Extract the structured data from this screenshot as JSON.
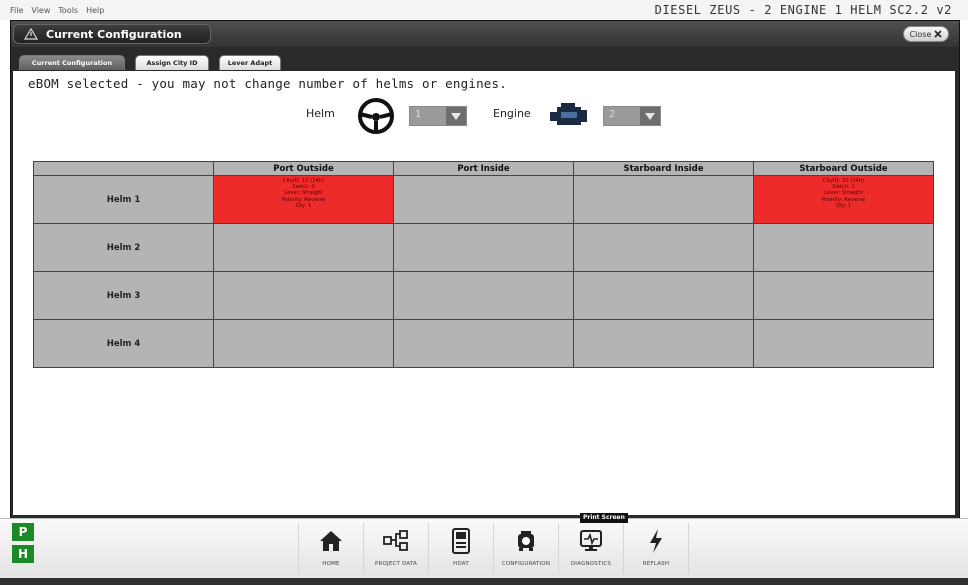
{
  "menu": {
    "items": [
      "File",
      "View",
      "Tools",
      "Help"
    ]
  },
  "app_title": "DIESEL ZEUS - 2 ENGINE 1 HELM SC2.2 v2",
  "window": {
    "title": "Current Configuration",
    "close_label": "Close"
  },
  "tabs": [
    {
      "label": "Current Configuration",
      "active": true
    },
    {
      "label": "Assign City ID",
      "active": false
    },
    {
      "label": "Lever Adapt",
      "active": false
    }
  ],
  "notice": "eBOM selected - you may not change number of helms or engines.",
  "helm_selector": {
    "label": "Helm",
    "value": "1"
  },
  "engine_selector": {
    "label": "Engine",
    "value": "2"
  },
  "table": {
    "columns": [
      "",
      "Port Outside",
      "Port Inside",
      "Starboard Inside",
      "Starboard Outside"
    ],
    "rows": [
      {
        "label": "Helm 1",
        "cells": [
          {
            "assigned": true,
            "lines": [
              "CityID: 10 (14h)",
              "Swtch: 0",
              "Lever: Straight",
              "Polarity: Reverse",
              "Qty: 1"
            ]
          },
          {
            "assigned": false,
            "lines": []
          },
          {
            "assigned": false,
            "lines": []
          },
          {
            "assigned": true,
            "lines": [
              "CityID: 10 (14h)",
              "Swtch: 1",
              "Lever: Straight",
              "Polarity: Reverse",
              "Qty: 1"
            ]
          }
        ]
      },
      {
        "label": "Helm 2",
        "cells": [
          {
            "assigned": false,
            "lines": []
          },
          {
            "assigned": false,
            "lines": []
          },
          {
            "assigned": false,
            "lines": []
          },
          {
            "assigned": false,
            "lines": []
          }
        ]
      },
      {
        "label": "Helm 3",
        "cells": [
          {
            "assigned": false,
            "lines": []
          },
          {
            "assigned": false,
            "lines": []
          },
          {
            "assigned": false,
            "lines": []
          },
          {
            "assigned": false,
            "lines": []
          }
        ]
      },
      {
        "label": "Helm 4",
        "cells": [
          {
            "assigned": false,
            "lines": []
          },
          {
            "assigned": false,
            "lines": []
          },
          {
            "assigned": false,
            "lines": []
          },
          {
            "assigned": false,
            "lines": []
          }
        ]
      }
    ]
  },
  "taskbar": {
    "badges": [
      "P",
      "H"
    ],
    "print_screen": "Print Screen",
    "nav": [
      {
        "label": "HOME",
        "icon": "home-icon"
      },
      {
        "label": "PROJECT DATA",
        "icon": "project-data-icon"
      },
      {
        "label": "HDAT",
        "icon": "hdat-icon"
      },
      {
        "label": "CONFIGURATION",
        "icon": "configuration-icon"
      },
      {
        "label": "DIAGNOSTICS",
        "icon": "diagnostics-icon"
      },
      {
        "label": "REFLASH",
        "icon": "reflash-icon"
      }
    ]
  },
  "colors": {
    "assigned_cell": "#ee2b2b",
    "empty_cell": "#b4b4b4",
    "window_chrome": "#2a2a2a",
    "badge_green": "#1d8a28"
  }
}
